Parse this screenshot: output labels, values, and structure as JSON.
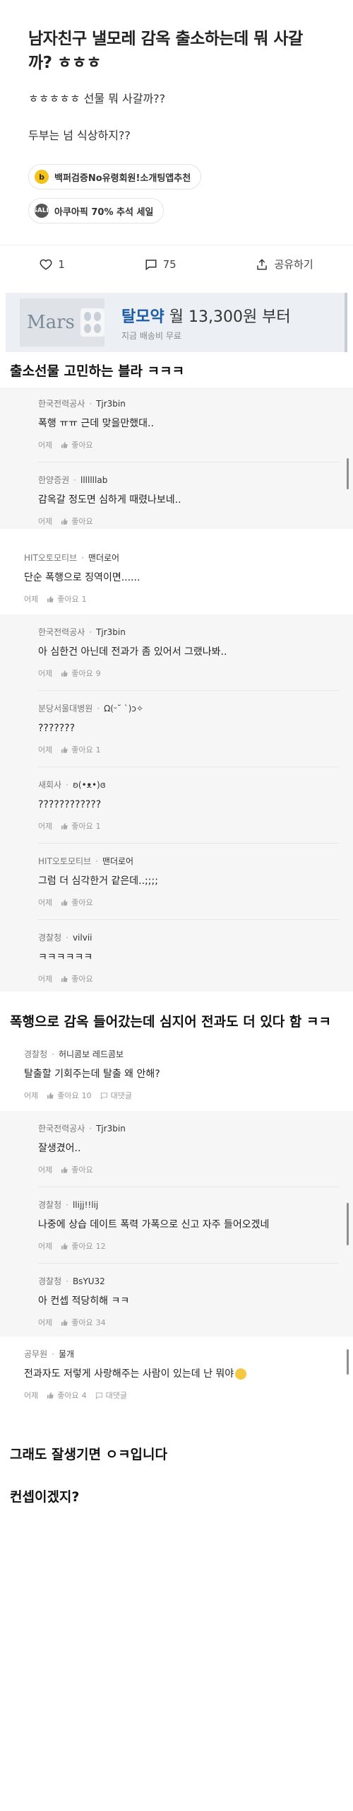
{
  "post": {
    "title": "남자친구 낼모레 감옥 출소하는데 뭐 사갈까? ㅎㅎㅎ",
    "body1": "ㅎㅎㅎㅎㅎ 선물 뭐 사갈까??",
    "body2": "두부는 넘 식상하지??",
    "pill1": "백퍼검증No유령회원!소개팅앱추천",
    "pill1_icon": "b",
    "pill2": "아쿠아픽 70% 추석 세일",
    "pill2_icon": "SALE",
    "likes": "1",
    "comments": "75",
    "share": "공유하기"
  },
  "ad": {
    "brand": "Mars",
    "name": "탈모약",
    "price": " 월 13,300원 부터",
    "sub": "지금 배송비 무료"
  },
  "captions": {
    "c1": "출소선물 고민하는 블라 ㅋㅋㅋ",
    "c2": "폭행으로 감옥 들어갔는데 심지어 전과도 더 있다 함 ㅋㅋ",
    "c3": "그래도 잘생기면 ㅇㅋ입니다",
    "c4": "컨셉이겠지?"
  },
  "labels": {
    "time": "어제",
    "like": "좋아요",
    "reply": "대댓글"
  },
  "shot1": [
    {
      "company": "한국전력공사",
      "nick": "Tjr3bin",
      "text": "폭행 ㅠㅠ 근데 맞을만했대..",
      "likes": ""
    },
    {
      "company": "한양증권",
      "nick": "lllllllab",
      "text": "감옥갈 정도면 심하게 때렸나보네..",
      "likes": ""
    }
  ],
  "shot2": [
    {
      "company": "HIT오토모티브",
      "nick": "맨더로어",
      "text": "단순 폭행으로 징역이면......",
      "likes": "1"
    },
    {
      "company": "한국전력공사",
      "nick": "Tjr3bin",
      "text": "아 심한건 아닌데 전과가 좀 있어서 그랬나봐..",
      "likes": "9"
    },
    {
      "company": "분당서울대병원",
      "nick": "Ω(ᵕ˘ `)ɔ✧",
      "text": "???????",
      "likes": "1"
    },
    {
      "company": "새회사",
      "nick": "ʚ(•ᴥ•)ɞ",
      "text": "????????????",
      "likes": "1"
    },
    {
      "company": "HIT오토모티브",
      "nick": "맨더로어",
      "text": "그럼 더 심각한거 같은데..;;;;",
      "likes": ""
    },
    {
      "company": "경찰청",
      "nick": "vilvii",
      "text": "ㅋㅋㅋㅋㅋㅋ",
      "likes": ""
    }
  ],
  "shot3": [
    {
      "company": "경찰청",
      "nick": "허니콤보 레드콤보",
      "text": "탈출할 기회주는데 탈출 왜 안해?",
      "likes": "10"
    },
    {
      "company": "한국전력공사",
      "nick": "Tjr3bin",
      "text": "잘생겼어..",
      "likes": ""
    },
    {
      "company": "경찰청",
      "nick": "llijj!!lij",
      "text": "나중에 상습 데이트 폭력 가폭으로 신고 자주 들어오겠네",
      "likes": "12"
    },
    {
      "company": "경찰청",
      "nick": "BsYU32",
      "text": "아 컨셉 적당히해 ㅋㅋ",
      "likes": "34"
    },
    {
      "company": "공무원",
      "nick": "물개",
      "text": "전과자도 저렇게 사랑해주는 사람이 있는데 난 뭐야",
      "likes": "4"
    }
  ]
}
